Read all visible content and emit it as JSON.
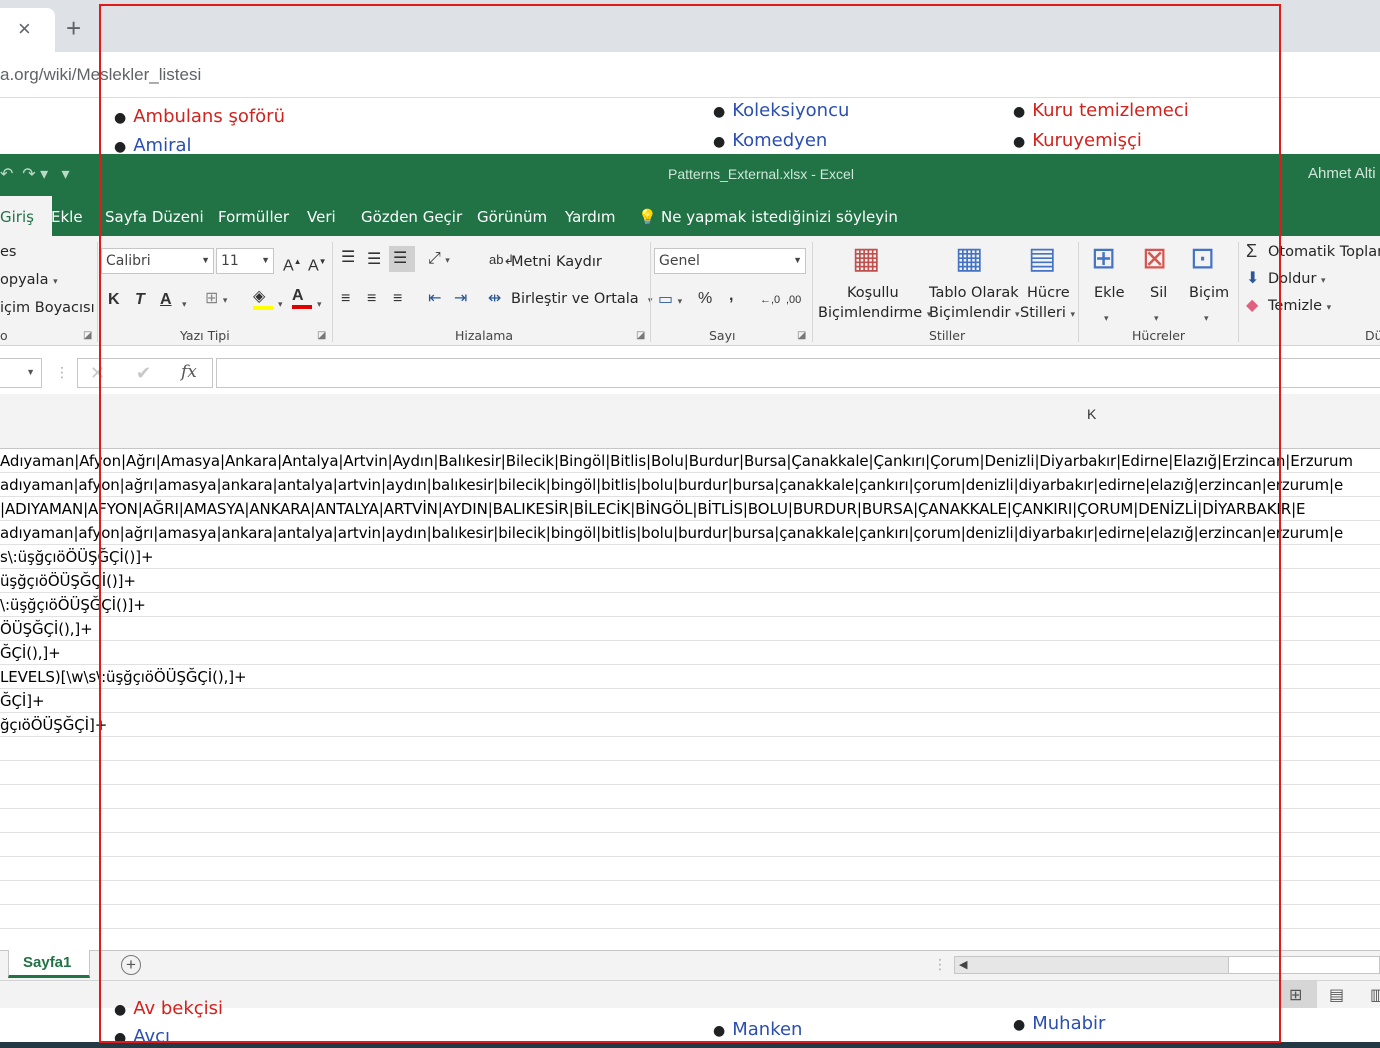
{
  "browser": {
    "tab_close": "×",
    "new_tab": "+",
    "url": "a.org/wiki/Meslekler_listesi"
  },
  "wiki_top": {
    "col1": [
      "Ambulans şoförü",
      "Amiral"
    ],
    "col2": [
      "Koleksiyoncu",
      "Komedyen"
    ],
    "col3": [
      "Kuru temizlemeci",
      "Kuruyemişçi"
    ]
  },
  "wiki_bottom": {
    "col1": [
      "Av bekçisi",
      "Avcı"
    ],
    "col2": [
      "Manken"
    ],
    "col3": [
      "Muhabir"
    ]
  },
  "excel": {
    "title": "Patterns_External.xlsx  -  Excel",
    "user": "Ahmet Alti",
    "tabs": {
      "home": "Giriş",
      "insert": "Ekle",
      "layout": "Sayfa Düzeni",
      "formulas": "Formüller",
      "data": "Veri",
      "review": "Gözden Geçir",
      "view": "Görünüm",
      "help": "Yardım",
      "tell": "Ne yapmak istediğinizi söyleyin"
    },
    "clipboard": {
      "cut": "es",
      "copy": "opyala",
      "painter": "içim Boyacısı",
      "group": "o"
    },
    "font": {
      "name": "Calibri",
      "size": "11",
      "group": "Yazı Tipi",
      "bold": "K",
      "italic": "T",
      "underline": "A"
    },
    "align": {
      "wrap": "Metni Kaydır",
      "merge": "Birleştir ve Ortala",
      "group": "Hizalama"
    },
    "number": {
      "format": "Genel",
      "group": "Sayı",
      "percent": "%",
      "comma": ","
    },
    "styles": {
      "cond1": "Koşullu",
      "cond2": "Biçimlendirme",
      "table1": "Tablo Olarak",
      "table2": "Biçimlendir",
      "cell1": "Hücre",
      "cell2": "Stilleri",
      "group": "Stiller"
    },
    "cells": {
      "insert": "Ekle",
      "delete": "Sil",
      "format": "Biçim",
      "group": "Hücreler"
    },
    "editing": {
      "autosum": "Otomatik Toplam",
      "fill": "Doldur",
      "clear": "Temizle",
      "group": "Dü"
    },
    "column_k": "K",
    "rows": [
      "Adıyaman|Afyon|Ağrı|Amasya|Ankara|Antalya|Artvin|Aydın|Balıkesir|Bilecik|Bingöl|Bitlis|Bolu|Burdur|Bursa|Çanakkale|Çankırı|Çorum|Denizli|Diyarbakır|Edirne|Elazığ|Erzincan|Erzurum",
      "adıyaman|afyon|ağrı|amasya|ankara|antalya|artvin|aydın|balıkesir|bilecik|bingöl|bitlis|bolu|burdur|bursa|çanakkale|çankırı|çorum|denizli|diyarbakır|edirne|elazığ|erzincan|erzurum|e",
      "|ADIYAMAN|AFYON|AĞRI|AMASYA|ANKARA|ANTALYA|ARTVİN|AYDIN|BALIKESİR|BİLECİK|BİNGÖL|BİTLİS|BOLU|BURDUR|BURSA|ÇANAKKALE|ÇANKIRI|ÇORUM|DENİZLİ|DİYARBAKIR|E",
      "adıyaman|afyon|ağrı|amasya|ankara|antalya|artvin|aydın|balıkesir|bilecik|bingöl|bitlis|bolu|burdur|bursa|çanakkale|çankırı|çorum|denizli|diyarbakır|edirne|elazığ|erzincan|erzurum|e",
      "s\\:üşğçıöÖÜŞĞÇİ()]+",
      "üşğçıöÖÜŞĞÇİ()]+",
      "\\:üşğçıöÖÜŞĞÇİ()]+",
      "ÖÜŞĞÇİ(),]+",
      "ĞÇİ(),]+",
      " LEVELS)[\\w\\s\\:üşğçıöÖÜŞĞÇİ(),]+",
      "ĞÇİ]+",
      "ğçıöÖÜŞĞÇİ]+",
      "",
      "",
      "",
      "",
      "",
      "",
      "",
      ""
    ],
    "sheet_tab": "Sayfa1",
    "add_sheet": "+"
  },
  "colors": {
    "excel_green": "#217346",
    "highlight": "#e01b1b",
    "link_red": "#d1221d",
    "link_blue": "#2b4fb0"
  }
}
